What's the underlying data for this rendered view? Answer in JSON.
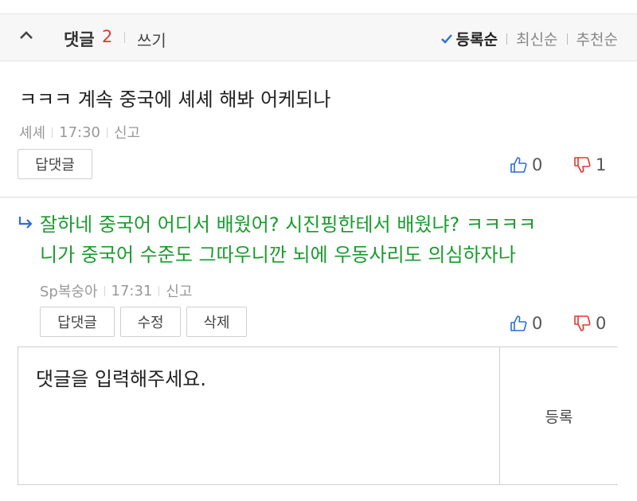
{
  "header": {
    "title": "댓글",
    "count": "2",
    "write_label": "쓰기",
    "sort_options": [
      "등록순",
      "최신순",
      "추천순"
    ],
    "active_sort": "등록순"
  },
  "comments": [
    {
      "text": "ㅋㅋㅋ 계속 중국에 셰셰 해봐 어케되나",
      "author": "셰셰",
      "time": "17:30",
      "report_label": "신고",
      "buttons": [
        "답댓글"
      ],
      "likes": "0",
      "dislikes": "1"
    },
    {
      "text_line1": "잘하네 중국어 어디서 배웠어? 시진핑한테서 배웠냐? ㅋㅋㅋㅋ",
      "text_line2": "니가 중국어 수준도 그따우니깐 뇌에 우동사리도 의심하자나",
      "author": "Sp복숭아",
      "time": "17:31",
      "report_label": "신고",
      "buttons": [
        "답댓글",
        "수정",
        "삭제"
      ],
      "likes": "0",
      "dislikes": "0",
      "is_reply": true
    }
  ],
  "input": {
    "placeholder": "댓글을 입력해주세요.",
    "submit_label": "등록"
  },
  "colors": {
    "count": "#e0372f",
    "reply_text": "#1a9b2e",
    "like_icon": "#2a6fd6",
    "dislike_icon": "#e0372f",
    "check": "#2a6fd6"
  }
}
